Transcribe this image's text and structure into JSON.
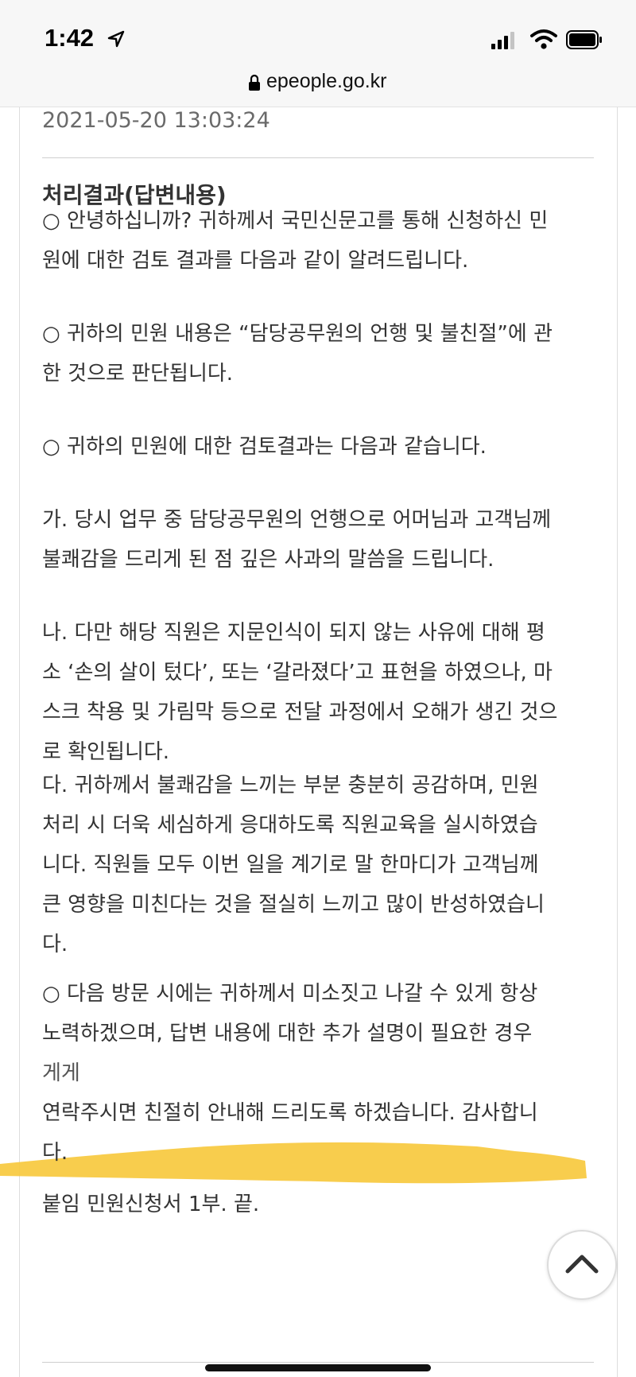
{
  "status_bar": {
    "time": "1:42",
    "icons": [
      "location-arrow-icon",
      "cellular-signal-icon",
      "wifi-icon",
      "battery-icon"
    ]
  },
  "browser": {
    "url": "epeople.go.kr",
    "icons": [
      "lock-icon"
    ]
  },
  "content": {
    "date": "2021-05-20 13:03:24",
    "section_title": "처리결과(답변내용)",
    "paragraphs": [
      [
        "○ 안녕하십니까? 귀하께서 국민신문고를 통해 신청하신 민",
        "원에 대한 검토 결과를 다음과 같이 알려드립니다."
      ],
      [
        "○ 귀하의 민원 내용은 “담당공무원의 언행 및 불친절”에 관",
        "한 것으로 판단됩니다."
      ],
      [
        "○ 귀하의 민원에 대한 검토결과는 다음과 같습니다."
      ],
      [
        "가. 당시 업무 중 담당공무원의 언행으로 어머님과 고객님께",
        "불쾌감을 드리게 된 점 깊은 사과의 말씀을 드립니다."
      ],
      [
        "나. 다만 해당 직원은 지문인식이 되지 않는 사유에 대해 평",
        "소 ‘손의 살이 텄다’, 또는 ‘갈라졌다’고 표현을 하였으나, 마",
        "스크 착용 및 가림막 등으로 전달 과정에서 오해가 생긴 것으",
        "로 확인됩니다."
      ],
      [
        "다. 귀하께서 불쾌감을 느끼는 부분 충분히 공감하며, 민원",
        "처리 시 더욱 세심하게 응대하도록 직원교육을 실시하였습",
        "니다. 직원들 모두 이번 일을 계기로 말 한마디가 고객님께",
        "큰 영향을 미친다는 것을 절실히 느끼고 많이 반성하였습니",
        "다."
      ],
      [
        "○ 다음 방문 시에는 귀하께서 미소짓고 나갈 수 있게 항상",
        "노력하겠으며, 답변 내용에 대한 추가 설명이 필요한 경우",
        "                                                                                                                        게게",
        "연락주시면 친절히 안내해 드리도록 하겠습니다. 감사합니",
        "다."
      ],
      [
        "붙임 민원신청서 1부. 끝."
      ]
    ]
  },
  "colors": {
    "highlight": "#f7c83a",
    "text": "#333333",
    "date": "#6a6a6a"
  },
  "controls": {
    "scroll_top_icon": "chevron-up-icon"
  }
}
